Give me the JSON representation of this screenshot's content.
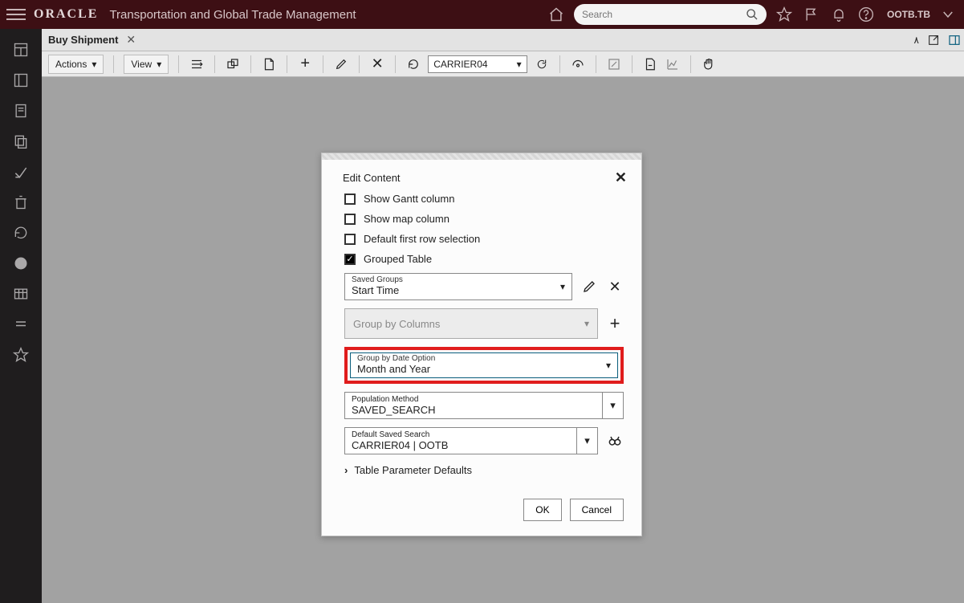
{
  "header": {
    "logo_text": "ORACLE",
    "app_title": "Transportation and Global Trade Management",
    "search_placeholder": "Search",
    "user_label": "OOTB.TB"
  },
  "tab": {
    "label": "Buy Shipment"
  },
  "toolbar": {
    "actions_label": "Actions",
    "view_label": "View",
    "carrier_value": "CARRIER04"
  },
  "modal": {
    "title": "Edit Content",
    "chk_gantt": "Show Gantt column",
    "chk_map": "Show map column",
    "chk_default_row": "Default first row selection",
    "chk_grouped": "Grouped Table",
    "saved_groups_label": "Saved Groups",
    "saved_groups_value": "Start Time",
    "group_by_columns_placeholder": "Group by Columns",
    "group_by_date_label": "Group by Date Option",
    "group_by_date_value": "Month and Year",
    "population_method_label": "Population Method",
    "population_method_value": "SAVED_SEARCH",
    "default_saved_search_label": "Default Saved Search",
    "default_saved_search_value": "CARRIER04 | OOTB",
    "table_param_defaults": "Table Parameter Defaults",
    "ok_label": "OK",
    "cancel_label": "Cancel"
  }
}
